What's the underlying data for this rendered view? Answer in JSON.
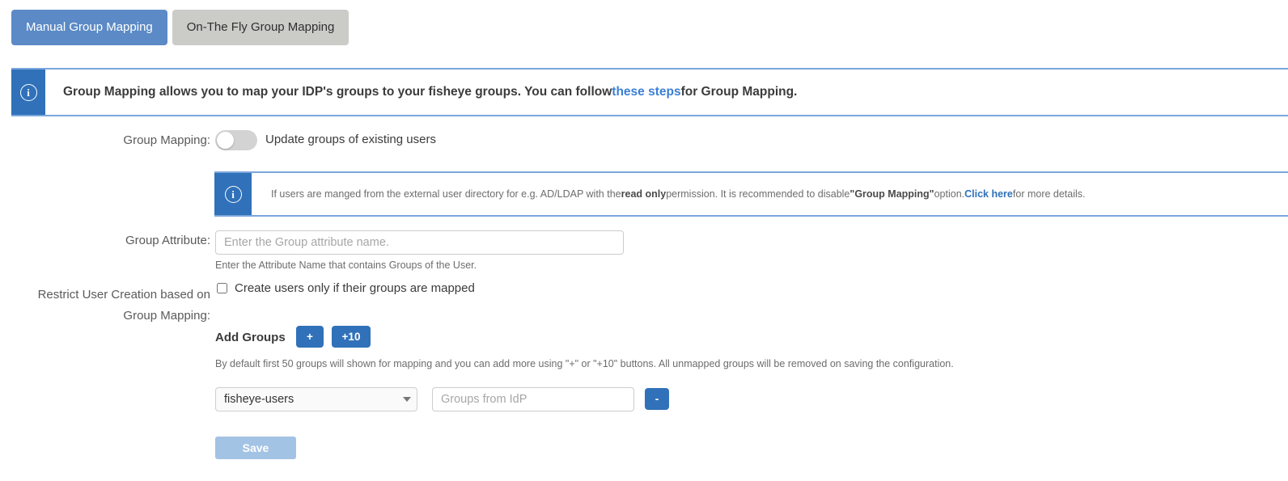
{
  "tabs": [
    {
      "label": "Manual Group Mapping",
      "active": true
    },
    {
      "label": "On-The Fly Group Mapping",
      "active": false
    }
  ],
  "alerts": {
    "top": {
      "icon": "info-icon",
      "text_before": "Group Mapping allows you to map your IDP's groups to your fisheye groups. You can follow ",
      "link": "these steps",
      "text_after": " for Group Mapping."
    },
    "inner": {
      "icon": "info-icon",
      "part1": "If users are manged from the external user directory for e.g. AD/LDAP with the ",
      "bold1": "read only",
      "part2": " permission. It is recommended to disable ",
      "bold2": "\"Group Mapping\"",
      "part3": " option. ",
      "link": "Click here",
      "part4": " for more details."
    }
  },
  "form": {
    "group_mapping_label": "Group Mapping:",
    "group_mapping_toggle_text": "Update groups of existing users",
    "group_mapping_toggle_state": "off",
    "group_attribute_label": "Group Attribute:",
    "group_attribute_value": "",
    "group_attribute_placeholder": "Enter the Group attribute name.",
    "group_attribute_hint": "Enter the Attribute Name that contains Groups of the User.",
    "restrict_label_line1": "Restrict User Creation based on",
    "restrict_label_line2": "Group Mapping:",
    "restrict_checkbox_label": "Create users only if their groups are mapped",
    "restrict_checkbox_checked": false,
    "add_groups_label": "Add Groups",
    "add_one_button": "+",
    "add_ten_button": "+10",
    "add_groups_hint": "By default first 50 groups will shown for mapping and you can add more using \"+\" or \"+10\" buttons. All unmapped groups will be removed on saving the configuration.",
    "mapping_row": {
      "selected_group": "fisheye-users",
      "group_options": [
        "fisheye-users"
      ],
      "idp_groups_value": "",
      "idp_groups_placeholder": "Groups from IdP",
      "remove_button": "-"
    },
    "save_button": "Save",
    "save_button_disabled": true
  },
  "colors": {
    "accent_blue": "#3071b9",
    "tab_active": "#5b8ac6",
    "tab_inactive": "#cbcbc8",
    "alert_border": "#7ba7dc",
    "link": "#3b7fd4",
    "save_disabled": "#a3c3e4"
  }
}
